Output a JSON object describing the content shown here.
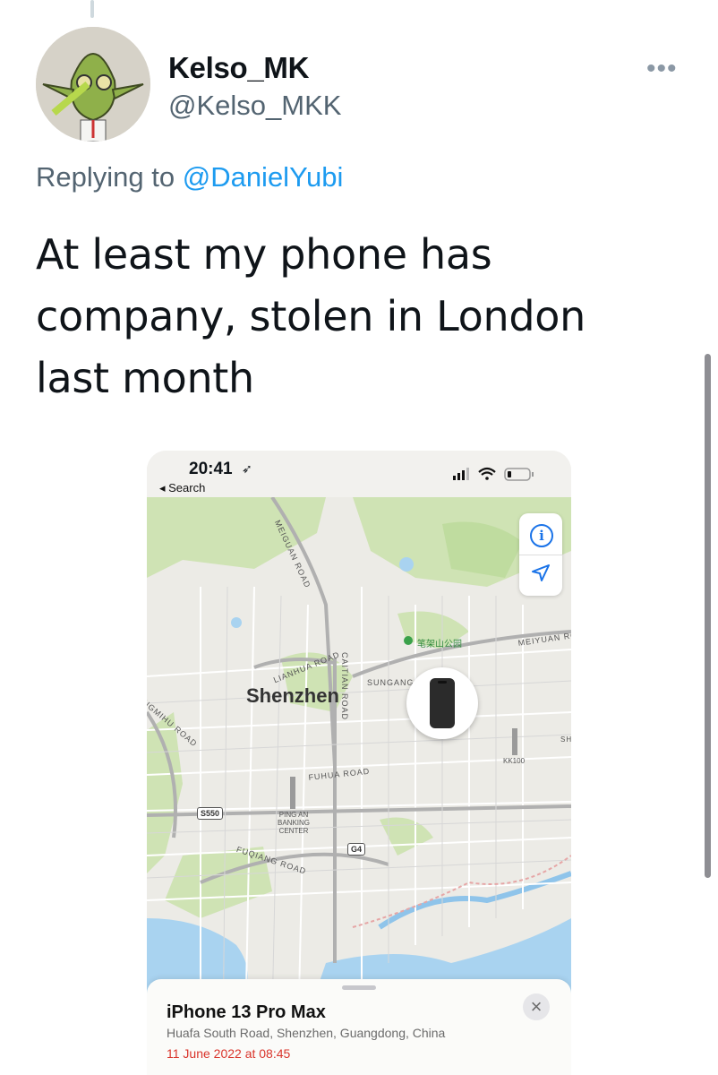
{
  "tweet": {
    "display_name": "Kelso_MK",
    "handle": "@Kelso_MKK",
    "more_label": "•••",
    "replying_prefix": "Replying to ",
    "replying_to": "@DanielYubi",
    "text": "At least my phone has\ncompany, stolen in London\nlast month"
  },
  "media": {
    "status_bar": {
      "time": "20:41",
      "back_label": "◂ Search"
    },
    "map": {
      "city": "Shenzhen",
      "labels": {
        "meiguan_road": "MEIGUAN ROAD",
        "lianhua_road": "LIANHUA ROAD",
        "caitian_road": "CAITIAN ROAD",
        "sungang": "SUNGANG",
        "park": "笔架山公园",
        "meiyuan_road": "MEIYUAN RO",
        "xinzhou_road": "NGMIHU ROAD",
        "fuhua_road": "FUHUA ROAD",
        "pingan": "PING AN\nBANKING\nCENTER",
        "fuqiang_road": "FUQIANG ROAD",
        "kk100": "KK100",
        "sh": "SH"
      },
      "shields": {
        "s550": "S550",
        "g4": "G4"
      }
    },
    "device": {
      "name": "iPhone 13 Pro Max",
      "address": "Huafa South Road, Shenzhen, Guangdong, China",
      "last_seen": "11 June 2022 at 08:45"
    },
    "icons": [
      "info-icon",
      "location-arrow-icon",
      "close-icon",
      "signal-icon",
      "wifi-icon",
      "battery-icon"
    ],
    "colors": {
      "last_seen": "#d9342b",
      "map_controls": "#1a73e8"
    }
  }
}
